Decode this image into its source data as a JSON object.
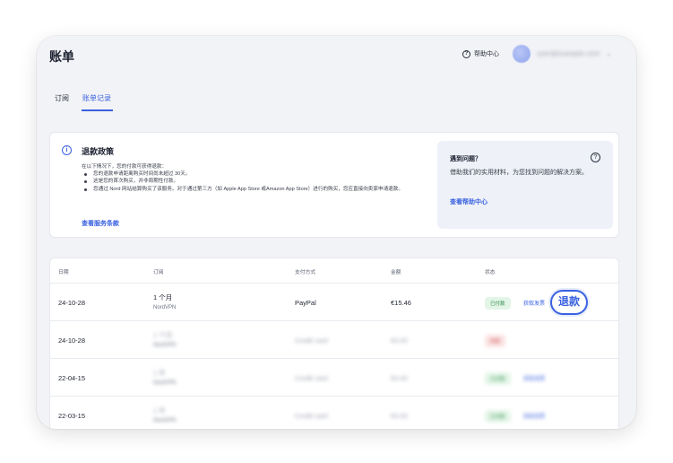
{
  "header": {
    "title": "账单",
    "help_label": "帮助中心",
    "account_email": "user@example.com",
    "chevron": "⌄"
  },
  "tabs": [
    {
      "label": "订阅",
      "active": false
    },
    {
      "label": "账单记录",
      "active": true
    }
  ],
  "policy": {
    "title": "退款政策",
    "intro": "在以下情况下，您的付款可获得退款：",
    "items": [
      "您的退款申请距离购买时间尚未超过 30天。",
      "这是您的首次购买，并非周期性付款。",
      "您通过 Nord 网站结算购买了该服务。对于通过第三方（如 Apple App Store 或Amazon App Store）进行的购买，您应直接向卖家申请退款。"
    ],
    "terms_link": "查看服务条款"
  },
  "help_box": {
    "title": "遇到问题？",
    "text": "借助我们的实用材料，为您找到问题的解决方案。",
    "link": "查看帮助中心"
  },
  "table": {
    "headers": [
      "日期",
      "订阅",
      "支付方式",
      "金额",
      "状态"
    ],
    "rows": [
      {
        "date": "24-10-28",
        "plan": "1 个月",
        "product": "NordVPN",
        "payment": "PayPal",
        "amount": "€15.46",
        "status": "已付款",
        "status_type": "paid",
        "invoice": "获取发票",
        "refund": "退款",
        "blurred": false
      },
      {
        "date": "24-10-28",
        "plan": "1 个月",
        "product": "NordVPN",
        "payment": "Credit card",
        "amount": "€0.00",
        "status": "失败",
        "status_type": "fail",
        "invoice": "",
        "blurred": true
      },
      {
        "date": "22-04-15",
        "plan": "1 年",
        "product": "NordVPN",
        "payment": "Credit card",
        "amount": "€0.00",
        "status": "已付款",
        "status_type": "paid",
        "invoice": "获取发票",
        "blurred": true
      },
      {
        "date": "22-03-15",
        "plan": "1 年",
        "product": "NordVPN",
        "payment": "Credit card",
        "amount": "€0.00",
        "status": "已付款",
        "status_type": "paid",
        "invoice": "获取发票",
        "blurred": true
      }
    ]
  },
  "colors": {
    "accent": "#3a61e0",
    "paid": "#2b8a46",
    "fail": "#c24141"
  },
  "icons": {
    "help": "question-circle-icon",
    "info": "info-circle-icon"
  }
}
